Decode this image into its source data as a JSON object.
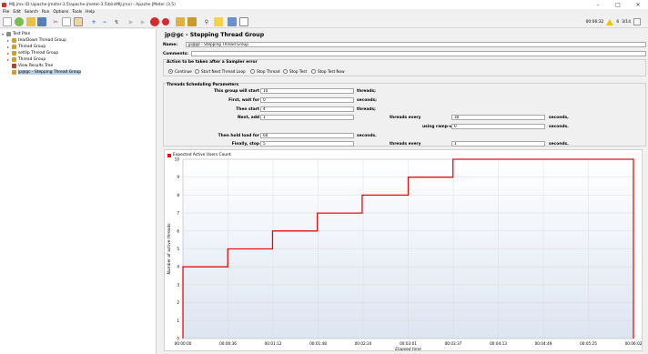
{
  "window": {
    "title": "MIJ.jmx (D:\\apache-jmeter-3.5\\apache-jmeter-3.5\\bin\\MIJ.jmx) - Apache JMeter (3.5)",
    "minimize": "–",
    "maximize": "□",
    "close": "✕"
  },
  "menu": [
    "File",
    "Edit",
    "Search",
    "Run",
    "Options",
    "Tools",
    "Help"
  ],
  "toolbar_icons": [
    "new-icon",
    "templates-icon",
    "open-icon",
    "save-icon",
    "cut-icon",
    "copy-icon",
    "paste-icon",
    "expand-icon",
    "collapse-icon",
    "toggle-icon",
    "start-icon",
    "start-no-pause-icon",
    "stop-icon",
    "shutdown-icon",
    "clear-icon",
    "clear-all-icon",
    "search-icon",
    "reset-search-icon",
    "function-helper-icon",
    "help-icon"
  ],
  "status": {
    "elapsed": "00:06:32",
    "warnings": "6",
    "threads": "3/14"
  },
  "tree": {
    "items": [
      {
        "label": "Test Plan",
        "icon": "test-plan-icon",
        "color": "#8a8a8a"
      },
      {
        "label": "tearDown Thread Group",
        "icon": "thread-group-icon",
        "color": "#d4a017"
      },
      {
        "label": "Thread Group",
        "icon": "thread-group-icon",
        "color": "#d4a017"
      },
      {
        "label": "setUp Thread Group",
        "icon": "thread-group-icon",
        "color": "#d4a017"
      },
      {
        "label": "Thread Group",
        "icon": "thread-group-icon",
        "color": "#d4a017"
      },
      {
        "label": "View Results Tree",
        "icon": "listener-icon",
        "color": "#c0392b"
      },
      {
        "label": "jp@gc - Stepping Thread Group",
        "icon": "thread-group-icon",
        "color": "#d4a017"
      }
    ]
  },
  "panel": {
    "title": "jp@gc - Stepping Thread Group",
    "name_label": "Name:",
    "name_value": "jp@gc - Stepping Thread Group",
    "comments_label": "Comments:",
    "comments_value": "",
    "error_section": "Action to be taken after a Sampler error",
    "actions": [
      "Continue",
      "Start Next Thread Loop",
      "Stop Thread",
      "Stop Test",
      "Stop Test Now"
    ],
    "selected_action": "Continue",
    "sched_section": "Threads Scheduling Parameters",
    "rows": [
      {
        "label": "This group will start",
        "value": "10",
        "unit": "threads;"
      },
      {
        "label": "First, wait for",
        "value": "0",
        "unit": "seconds;"
      },
      {
        "label": "Then start",
        "value": "4",
        "unit": "threads;"
      },
      {
        "label": "Next, add",
        "value": "1",
        "unit": "threads every",
        "value2": "30",
        "unit2": "seconds,"
      },
      {
        "label": "",
        "value": "",
        "unit": "using ramp-up",
        "value2": "0",
        "unit2": "seconds."
      },
      {
        "label": "Then hold load for",
        "value": "60",
        "unit": "seconds."
      },
      {
        "label": "Finally, stop",
        "value": "5",
        "unit": "threads every",
        "value2": "1",
        "unit2": "seconds."
      }
    ]
  },
  "chart_data": {
    "type": "line",
    "legend": [
      "Expected Active Users Count"
    ],
    "ylabel": "Number of active threads",
    "xlabel": "Elapsed time",
    "ylim": [
      0,
      10
    ],
    "yticks": [
      0,
      1,
      2,
      3,
      4,
      5,
      6,
      7,
      8,
      9,
      10
    ],
    "xticks": [
      "00:00:00",
      "00:00:36",
      "00:01:12",
      "00:01:48",
      "00:02:24",
      "00:03:01",
      "00:03:37",
      "00:04:13",
      "00:04:49",
      "00:05:25",
      "00:06:02"
    ],
    "xrange_seconds": [
      0,
      362
    ],
    "series": [
      {
        "name": "Expected Active Users Count",
        "color": "#e01010",
        "points": [
          [
            0,
            0
          ],
          [
            0,
            4
          ],
          [
            36,
            4
          ],
          [
            36,
            5
          ],
          [
            72,
            5
          ],
          [
            72,
            6
          ],
          [
            108,
            6
          ],
          [
            108,
            7
          ],
          [
            144,
            7
          ],
          [
            144,
            8
          ],
          [
            181,
            8
          ],
          [
            181,
            9
          ],
          [
            217,
            9
          ],
          [
            217,
            10
          ],
          [
            254,
            10
          ],
          [
            254,
            10
          ],
          [
            362,
            10
          ],
          [
            362,
            0
          ]
        ]
      }
    ]
  }
}
